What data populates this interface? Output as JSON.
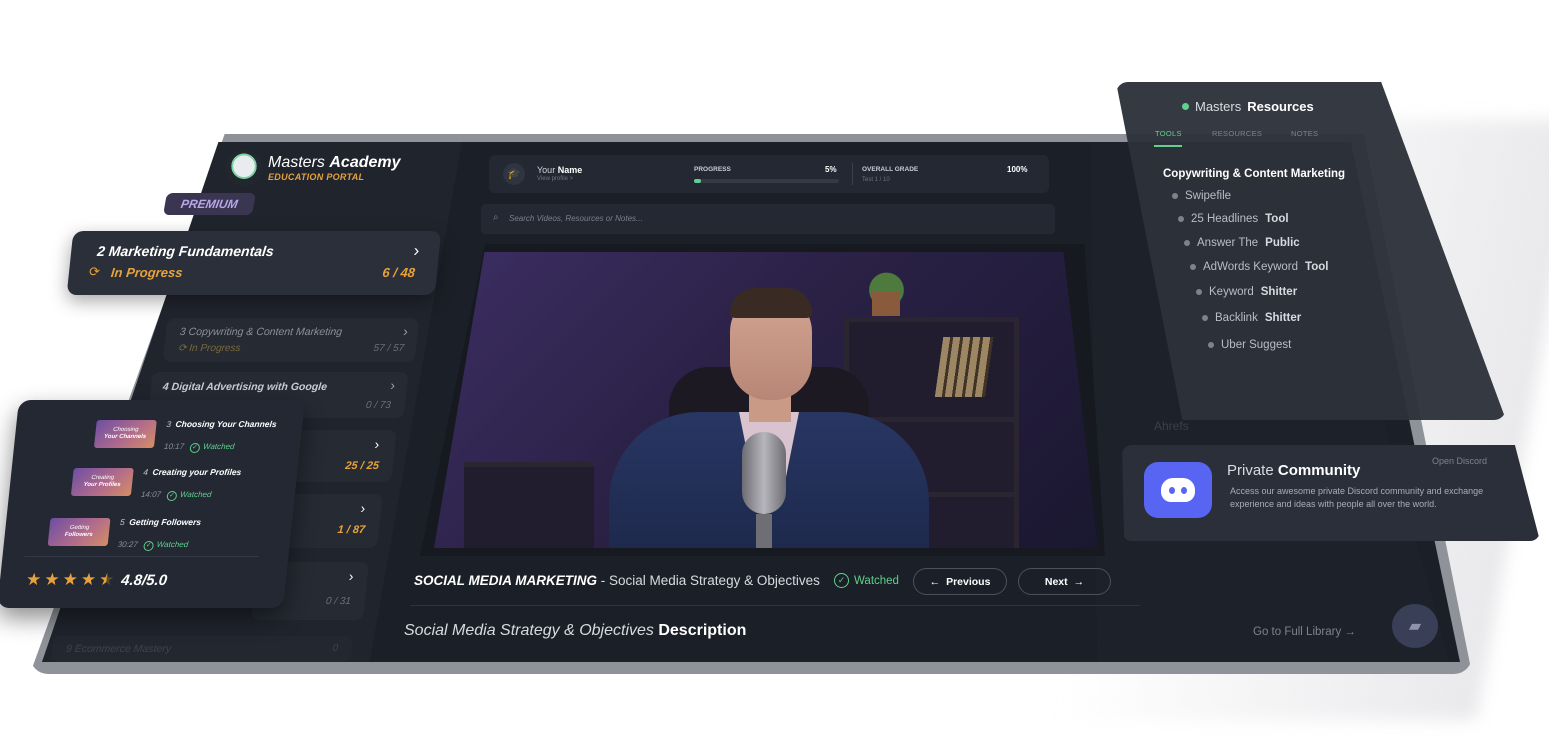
{
  "logo": {
    "title_light": "Masters",
    "title_bold": "Academy",
    "subtitle": "EDUCATION PORTAL"
  },
  "premium_badge": "PREMIUM",
  "current_module": {
    "number": "2",
    "title": "Marketing Fundamentals",
    "status": "In Progress",
    "count": "6 / 48"
  },
  "modules": [
    {
      "number": "3",
      "title": "Copywriting & Content Marketing",
      "status": "In Progress",
      "count": "57 / 57"
    },
    {
      "number": "4",
      "title": "Digital Advertising with Google",
      "count": "0 / 73"
    },
    {
      "count": "25 / 25"
    },
    {
      "count": "1 / 87"
    },
    {
      "count": "0 / 31"
    },
    {
      "number": "9",
      "title": "Ecommerce Mastery",
      "count": "0"
    }
  ],
  "lessons": [
    {
      "number": "3",
      "title": "Choosing Your Channels",
      "duration": "10:17",
      "status": "Watched",
      "thumb_l1": "Choosing",
      "thumb_l2": "Your Channels"
    },
    {
      "number": "4",
      "title": "Creating your Profiles",
      "duration": "14:07",
      "status": "Watched",
      "thumb_l1": "Creating",
      "thumb_l2": "Your Profiles"
    },
    {
      "number": "5",
      "title": "Getting Followers",
      "duration": "30:27",
      "status": "Watched",
      "thumb_l1": "Getting",
      "thumb_l2": "Followers"
    }
  ],
  "rating": {
    "value": "4.8/5.0",
    "stars": 4.5
  },
  "profile": {
    "name_prefix": "Your",
    "name_bold": "Name",
    "view_link": "View profile >"
  },
  "progress": {
    "label": "PROGRESS",
    "value": "5%",
    "fraction": 0.05
  },
  "grade": {
    "label": "OVERALL GRADE",
    "value": "100%",
    "sub": "Test 1 / 10"
  },
  "search": {
    "placeholder": "Search Videos, Resources or Notes..."
  },
  "video": {
    "course": "SOCIAL MEDIA MARKETING",
    "lesson_title": " - Social Media Strategy & Objectives",
    "status": "Watched",
    "prev_label": "Previous",
    "next_label": "Next",
    "desc_light": "Social Media Strategy & Objectives",
    "desc_bold": "Description"
  },
  "library_link": "Go to Full Library",
  "resources": {
    "title_light": "Masters",
    "title_bold": "Resources",
    "tabs": [
      "TOOLS",
      "RESOURCES",
      "NOTES"
    ],
    "heading": "Copywriting & Content Marketing",
    "items": [
      {
        "light": "Swipefile",
        "bold": ""
      },
      {
        "light": "25 Headlines",
        "bold": "Tool"
      },
      {
        "light": "Answer The",
        "bold": "Public"
      },
      {
        "light": "AdWords Keyword",
        "bold": "Tool"
      },
      {
        "light": "Keyword",
        "bold": "Shitter"
      },
      {
        "light": "Backlink",
        "bold": "Shitter"
      },
      {
        "light": "Uber Suggest",
        "bold": ""
      }
    ]
  },
  "background_list": [
    "Ahrefs"
  ],
  "community": {
    "title_light": "Private",
    "title_bold": "Community",
    "open_link": "Open Discord",
    "text": "Access our awesome private Discord community and exchange experience and ideas with people all over the world."
  },
  "colors": {
    "accent_green": "#5fd08d",
    "accent_orange": "#e8a23c",
    "background": "#1b1f27",
    "discord": "#5865f2",
    "premium": "#b8a7e8"
  }
}
